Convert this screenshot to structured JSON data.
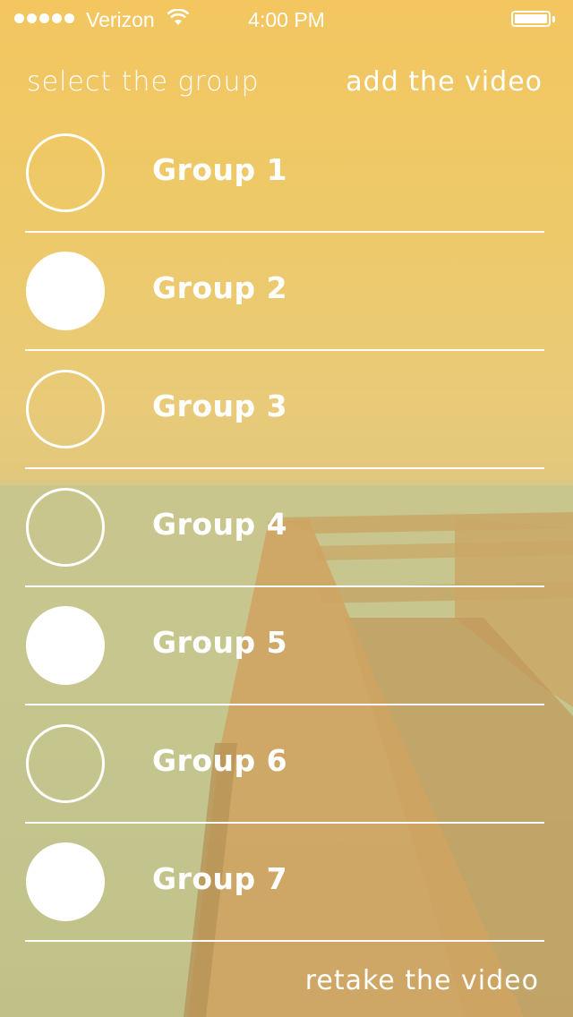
{
  "status_bar": {
    "carrier": "Verizon",
    "time": "4:00 PM",
    "signal_icon": "signal-dots-icon",
    "wifi_icon": "wifi-icon",
    "battery_icon": "battery-icon"
  },
  "header": {
    "left_action": "select the group",
    "right_action": "add the video"
  },
  "groups": [
    {
      "label": "Group 1",
      "selected": false
    },
    {
      "label": "Group 2",
      "selected": true
    },
    {
      "label": "Group 3",
      "selected": false
    },
    {
      "label": "Group 4",
      "selected": false
    },
    {
      "label": "Group 5",
      "selected": true
    },
    {
      "label": "Group 6",
      "selected": false
    },
    {
      "label": "Group 7",
      "selected": true
    }
  ],
  "footer": {
    "action": "retake the video"
  },
  "colors": {
    "overlay": "#efc866",
    "foreground": "#ffffff"
  }
}
